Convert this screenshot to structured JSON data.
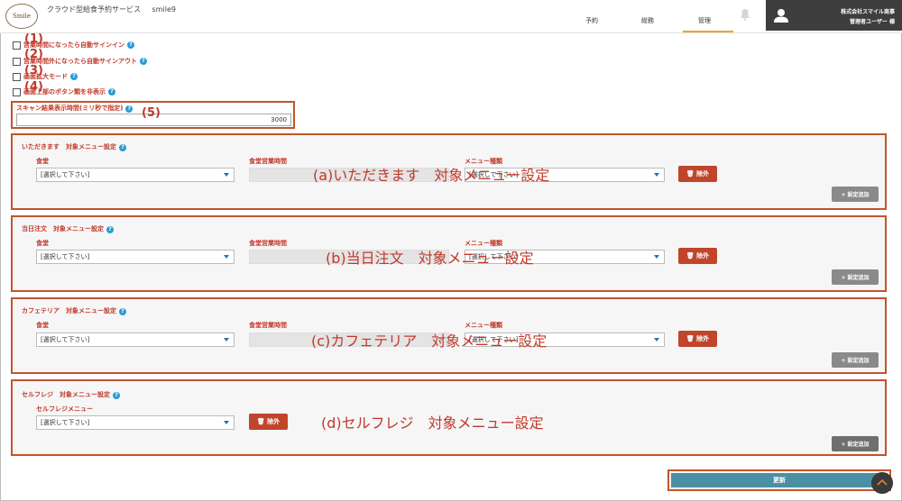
{
  "header": {
    "logo_text": "Smile",
    "app_title": "クラウド型給食予約サービス",
    "app_user": "smile9",
    "nav": [
      {
        "label": "予約"
      },
      {
        "label": "総務"
      },
      {
        "label": "管理"
      }
    ],
    "active_nav": "管理",
    "company": "株式会社スマイル商事",
    "role": "管理者ユーザー 様"
  },
  "options": [
    {
      "label": "営業時間になったら自動サインイン",
      "checked": false,
      "annotation": "(1)"
    },
    {
      "label": "営業時間外になったら自動サインアウト",
      "checked": false,
      "annotation": "(2)"
    },
    {
      "label": "画面拡大モード",
      "checked": false,
      "annotation": "(3)"
    },
    {
      "label": "画面上部のボタン類を非表示",
      "checked": false,
      "annotation": "(4)"
    }
  ],
  "scan": {
    "label": "スキャン結果表示時間(ミリ秒で指定)",
    "value": "3000",
    "annotation": "(5)"
  },
  "sections": [
    {
      "title": "いただきます　対象メニュー設定",
      "fields": {
        "dining": "食堂",
        "hours": "食堂営業時間",
        "menu_type": "メニュー種類"
      },
      "dining_value": "[選択して下さい]",
      "menu_type_value": "[選択して下さい]",
      "delete_label": "除外",
      "add_label": "+ 設定追加",
      "overlay": "(a)いただきます　対象メニュー設定"
    },
    {
      "title": "当日注文　対象メニュー設定",
      "fields": {
        "dining": "食堂",
        "hours": "食堂営業時間",
        "menu_type": "メニュー種類"
      },
      "dining_value": "[選択して下さい]",
      "menu_type_value": "[選択して下さい]",
      "delete_label": "除外",
      "add_label": "+ 設定追加",
      "overlay": "(b)当日注文　対象メニュー設定"
    },
    {
      "title": "カフェテリア　対象メニュー設定",
      "fields": {
        "dining": "食堂",
        "hours": "食堂営業時間",
        "menu_type": "メニュー種類"
      },
      "dining_value": "[選択して下さい]",
      "menu_type_value": "[選択して下さい]",
      "delete_label": "除外",
      "add_label": "+ 設定追加",
      "overlay": "(c)カフェテリア　対象メニュー設定"
    },
    {
      "title": "セルフレジ　対象メニュー設定",
      "fields": {
        "menu": "セルフレジメニュー"
      },
      "menu_value": "[選択して下さい]",
      "delete_label": "除外",
      "add_label": "+ 設定追加",
      "overlay": "(d)セルフレジ　対象メニュー設定"
    }
  ],
  "update_label": "更新",
  "colors": {
    "accent": "#c0392b",
    "annotation_border": "#c0552b",
    "update": "#4a90a4",
    "nav_active": "#f0a030",
    "help": "#2a9ad6"
  }
}
